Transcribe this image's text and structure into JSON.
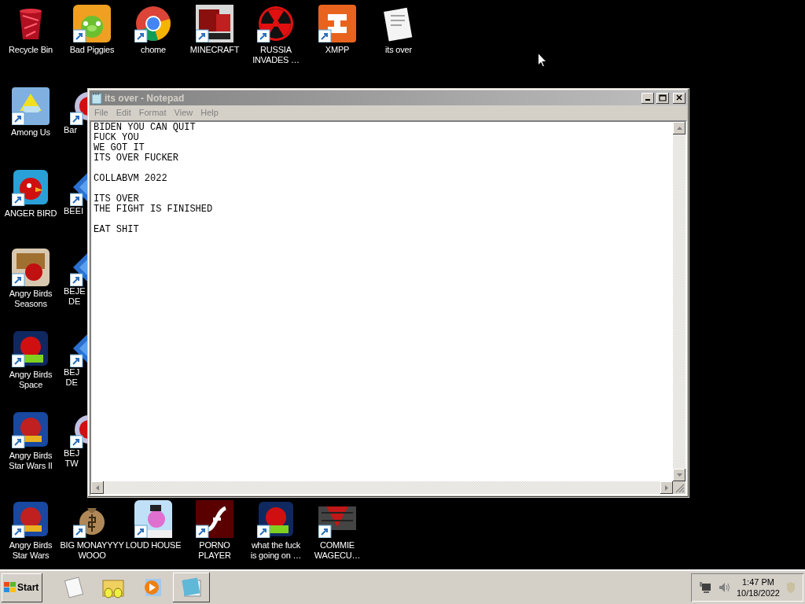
{
  "desktop": {
    "icons": [
      {
        "label": "Recycle Bin",
        "kind": "bin",
        "shortcut": false
      },
      {
        "label": "Bad Piggies",
        "kind": "pig",
        "shortcut": true
      },
      {
        "label": "chome",
        "kind": "browser",
        "shortcut": true
      },
      {
        "label": "MINECRAFT",
        "kind": "block",
        "shortcut": true
      },
      {
        "label": "RUSSIA\nINVADES …",
        "kind": "radiation",
        "shortcut": true
      },
      {
        "label": "XMPP",
        "kind": "xampp",
        "shortcut": true
      },
      {
        "label": "its over",
        "kind": "document",
        "shortcut": false
      },
      {
        "label": "Among Us",
        "kind": "hat",
        "shortcut": true
      },
      {
        "label": "ANGER BIRD",
        "kind": "bird",
        "shortcut": true
      },
      {
        "label": "Angry Birds\nSeasons",
        "kind": "seasons",
        "shortcut": true
      },
      {
        "label": "Angry Birds\nSpace",
        "kind": "space",
        "shortcut": true
      },
      {
        "label": "Angry Birds\nStar Wars II",
        "kind": "starwars",
        "shortcut": true
      },
      {
        "label": "Angry Birds\nStar Wars",
        "kind": "starwars",
        "shortcut": true
      },
      {
        "label": "BIG MONAYYYY\nWOOO",
        "kind": "money",
        "shortcut": true
      },
      {
        "label": "LOUD HOUSE",
        "kind": "sky",
        "shortcut": true
      },
      {
        "label": "PORNO\nPLAYER",
        "kind": "flash",
        "shortcut": true
      },
      {
        "label": "what the fuck\nis going on …",
        "kind": "space",
        "shortcut": true
      },
      {
        "label": "COMMIE\nWAGECU…",
        "kind": "emblem",
        "shortcut": true
      }
    ],
    "covered_icons": [
      {
        "label": "Bar",
        "kind": "ring"
      },
      {
        "label": "BEEI",
        "kind": "gem"
      },
      {
        "label": "BEJE DE",
        "kind": "gem"
      },
      {
        "label": "BEJ DE",
        "kind": "gem"
      },
      {
        "label": "BEJ TW",
        "kind": "ring"
      }
    ]
  },
  "notepad": {
    "title": "its over - Notepad",
    "active": false,
    "menu": [
      "File",
      "Edit",
      "Format",
      "View",
      "Help"
    ],
    "text": "BIDEN YOU CAN QUIT\nFUCK YOU\nWE GOT IT\nITS OVER FUCKER\n\nCOLLABVM 2022\n\nITS OVER\nTHE FIGHT IS FINISHED\n\nEAT SHIT"
  },
  "taskbar": {
    "start": "Start",
    "quick_launch": [
      {
        "kind": "paper",
        "selected": false
      },
      {
        "kind": "folder",
        "selected": false
      },
      {
        "kind": "player",
        "selected": false
      },
      {
        "kind": "notepad",
        "selected": true
      }
    ],
    "clock": {
      "time": "1:47 PM",
      "date": "10/18/2022"
    }
  }
}
